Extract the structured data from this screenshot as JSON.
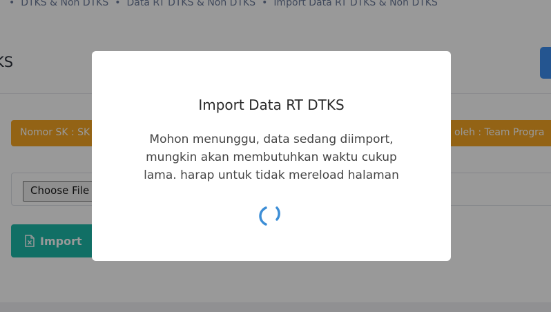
{
  "breadcrumb": {
    "items": [
      "DTKS & Non DTKS",
      "Data RT DTKS & Non DTKS",
      "Import Data RT DTKS & Non DTKS"
    ]
  },
  "page": {
    "title": "KS"
  },
  "alert": {
    "left_text": "Nomor SK : SK",
    "right_text": "oleh : Team Progra"
  },
  "file_input": {
    "button_label": "Choose File"
  },
  "actions": {
    "import_label": "Import",
    "import_icon": "excel-file-icon"
  },
  "modal": {
    "title": "Import Data RT DTKS",
    "message": "Mohon menunggu, data sedang diimport, mungkin akan membutuhkan waktu cukup lama. harap untuk tidak mereload halaman",
    "spinner_icon": "loading-spinner-icon"
  },
  "colors": {
    "warning": "#f5a623",
    "success": "#1db9a8",
    "primary": "#3d8ef0",
    "spinner": "#3d8ed6"
  }
}
